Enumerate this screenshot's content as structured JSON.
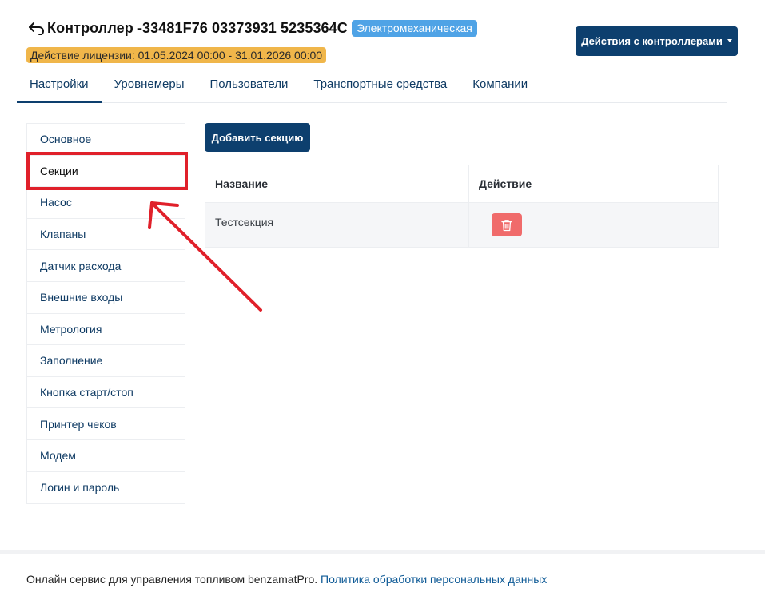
{
  "header": {
    "title": "Контроллер -33481F76 03373931 5235364C",
    "type_badge": "Электромеханическая",
    "license": "Действие лицензии: 01.05.2024 00:00 - 31.01.2026 00:00",
    "actions_label": "Действия с контроллерами"
  },
  "tabs": [
    {
      "label": "Настройки"
    },
    {
      "label": "Уровнемеры"
    },
    {
      "label": "Пользователи"
    },
    {
      "label": "Транспортные средства"
    },
    {
      "label": "Компании"
    }
  ],
  "sidebar": {
    "items": [
      {
        "label": "Основное"
      },
      {
        "label": "Секции"
      },
      {
        "label": "Насос"
      },
      {
        "label": "Клапаны"
      },
      {
        "label": "Датчик расхода"
      },
      {
        "label": "Внешние входы"
      },
      {
        "label": "Метрология"
      },
      {
        "label": "Заполнение"
      },
      {
        "label": "Кнопка старт/стоп"
      },
      {
        "label": "Принтер чеков"
      },
      {
        "label": "Модем"
      },
      {
        "label": "Логин и пароль"
      }
    ]
  },
  "main": {
    "add_label": "Добавить секцию",
    "table": {
      "headers": [
        "Название",
        "Действие"
      ],
      "rows": [
        {
          "name": "Тестсекция"
        }
      ]
    }
  },
  "footer": {
    "text": "Онлайн сервис для управления топливом benzamatPro.",
    "link": "Политика обработки персональных данных"
  },
  "colors": {
    "primary": "#0d3f6e",
    "badge_blue": "#4fa3e6",
    "badge_yellow": "#f0b64a",
    "danger": "#f06b6b",
    "annotation_red": "#e0202a"
  },
  "icons": {
    "back": "back-arrow-icon",
    "caret": "caret-down-icon",
    "delete": "trash-icon"
  }
}
